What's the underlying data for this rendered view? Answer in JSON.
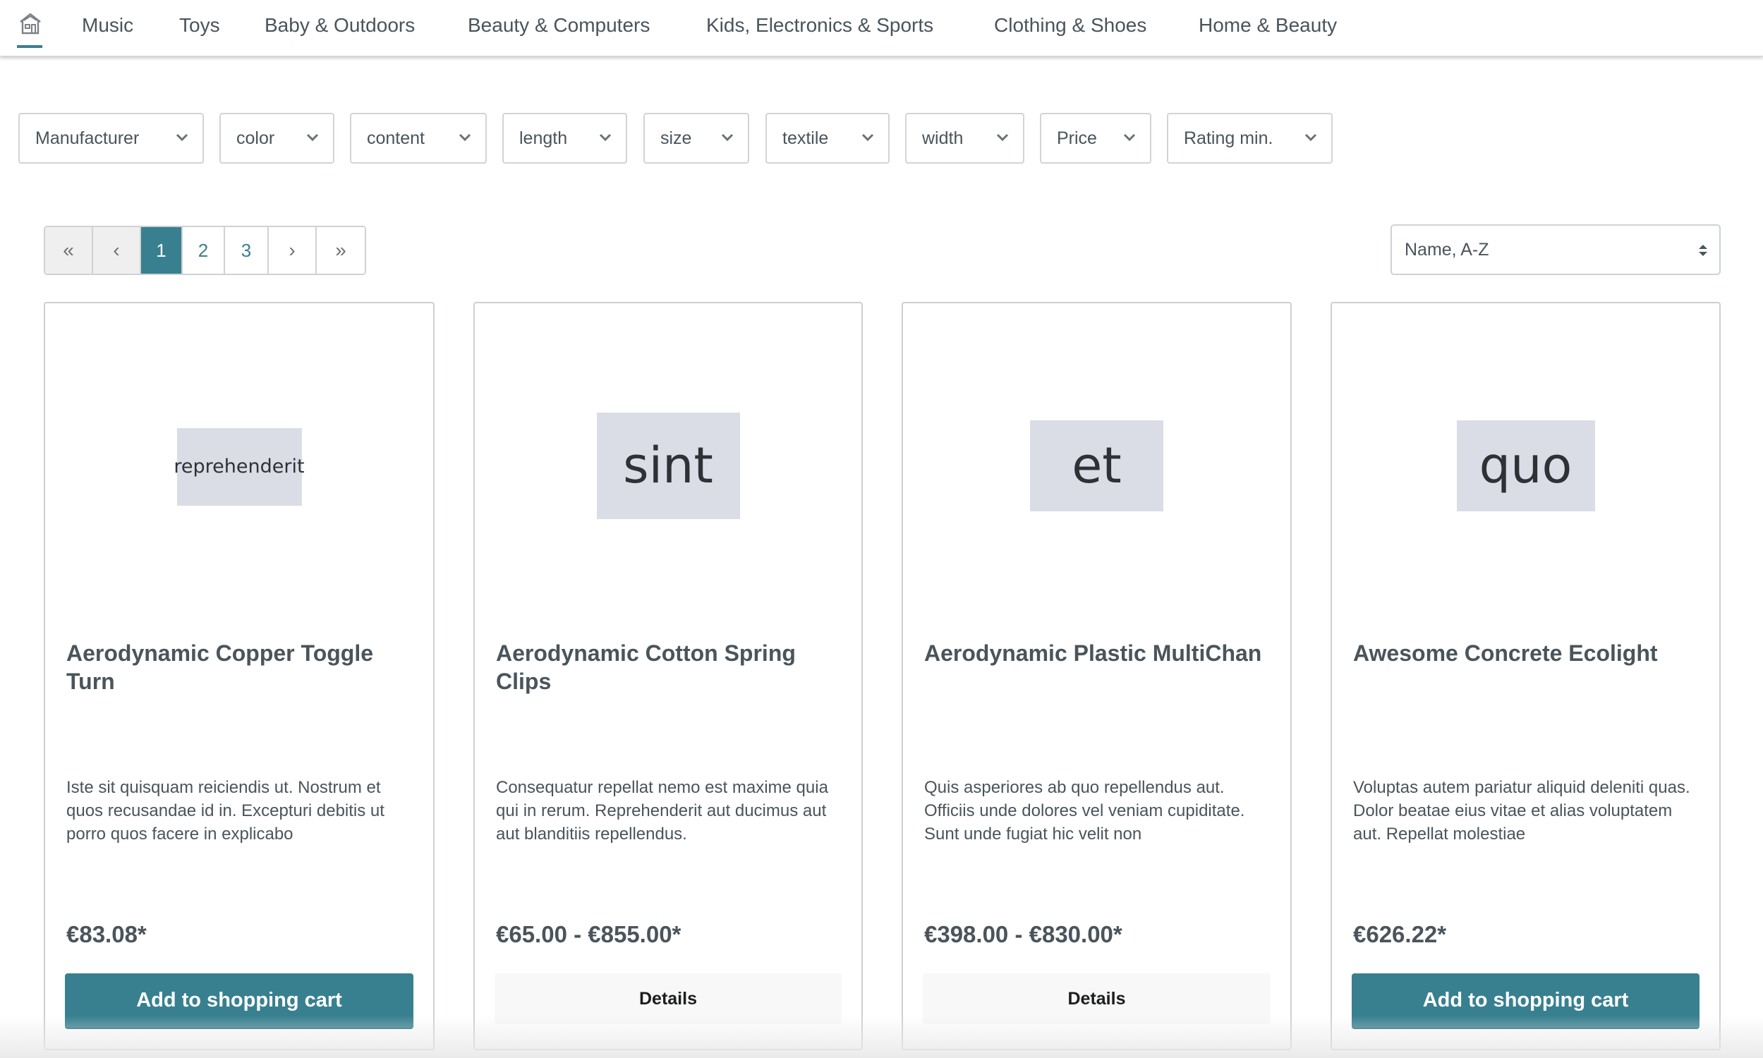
{
  "nav": {
    "home_icon": "home-icon",
    "items": [
      "Music",
      "Toys",
      "Baby & Outdoors",
      "Beauty & Computers",
      "Kids, Electronics & Sports",
      "Clothing & Shoes",
      "Home & Beauty"
    ]
  },
  "filters": [
    "Manufacturer",
    "color",
    "content",
    "length",
    "size",
    "textile",
    "width",
    "Price",
    "Rating min."
  ],
  "pagination": {
    "first": "«",
    "prev": "‹",
    "pages": [
      "1",
      "2",
      "3"
    ],
    "current_page": "1",
    "next": "›",
    "last": "»"
  },
  "sort": {
    "selected": "Name, A-Z"
  },
  "colors": {
    "accent": "#388090",
    "text": "#4a545b",
    "placeholder_bg": "#dadde5"
  },
  "products": [
    {
      "image_text": "reprehenderit",
      "name": "Aerodynamic Copper Toggle Turn",
      "description": "Iste sit quisquam reiciendis ut. Nostrum et quos recusandae id in. Excepturi debitis ut porro quos facere in explicabo",
      "price": "€83.08*",
      "action": "Add to shopping cart"
    },
    {
      "image_text": "sint",
      "name": "Aerodynamic Cotton Spring Clips",
      "description": "Consequatur repellat nemo est maxime quia qui in rerum. Reprehenderit aut ducimus aut aut blanditiis repellendus.",
      "price": "€65.00 - €855.00*",
      "action": "Details"
    },
    {
      "image_text": "et",
      "name": "Aerodynamic Plastic MultiChan",
      "description": "Quis asperiores ab quo repellendus aut. Officiis unde dolores vel veniam cupiditate. Sunt unde fugiat hic velit non",
      "price": "€398.00 - €830.00*",
      "action": "Details"
    },
    {
      "image_text": "quo",
      "name": "Awesome Concrete Ecolight",
      "description": "Voluptas autem pariatur aliquid deleniti quas. Dolor beatae eius vitae et alias voluptatem aut. Repellat molestiae",
      "price": "€626.22*",
      "action": "Add to shopping cart"
    }
  ]
}
